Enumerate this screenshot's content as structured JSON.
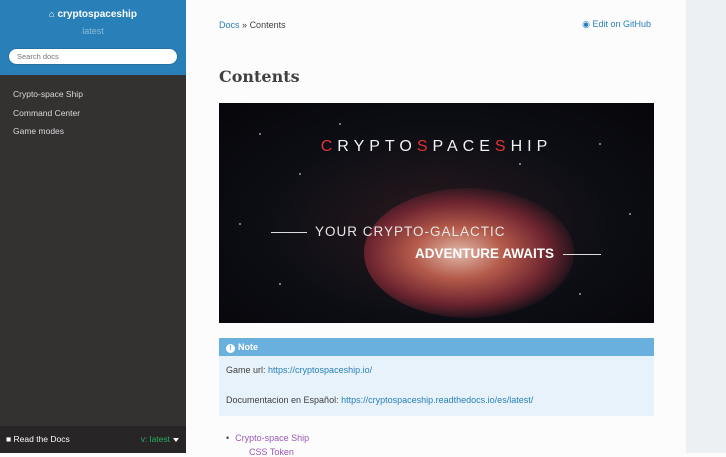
{
  "sidebar": {
    "project_title": "cryptospaceship",
    "version": "latest",
    "search_placeholder": "Search docs",
    "items": [
      {
        "label": "Crypto-space Ship"
      },
      {
        "label": "Command Center"
      },
      {
        "label": "Game modes"
      }
    ],
    "footer": {
      "rtd_label": "Read the Docs",
      "version_label": "v: latest"
    }
  },
  "breadcrumb": {
    "root": "Docs",
    "separator": "»",
    "current": "Contents"
  },
  "github_link": "Edit on GitHub",
  "page_title": "Contents",
  "banner": {
    "logo_pre": "CRYPTO",
    "logo_red_s": "S",
    "logo_mid": "PACE",
    "logo_red_s2": "S",
    "logo_post": "HIP",
    "logo_red_c": "C",
    "tagline_1": "YOUR CRYPTO-GALACTIC",
    "tagline_2": "ADVENTURE AWAITS"
  },
  "note": {
    "title": "Note",
    "game_url_label": "Game url:",
    "game_url": "https://cryptospaceship.io/",
    "doc_es_label": "Documentacion en Español:",
    "doc_es_url": "https://cryptospaceship.readthedocs.io/es/latest/"
  },
  "toc": {
    "item1": "Crypto-space Ship",
    "item1_sub": "CSS Token"
  },
  "colors": {
    "sidebar_top": "#2980b9",
    "sidebar_bg": "#343131",
    "link": "#2980b9",
    "visited_link": "#9b59b6",
    "note_header": "#6ab0de",
    "note_bg": "#e7f2fa",
    "version_green": "#27ae60"
  }
}
